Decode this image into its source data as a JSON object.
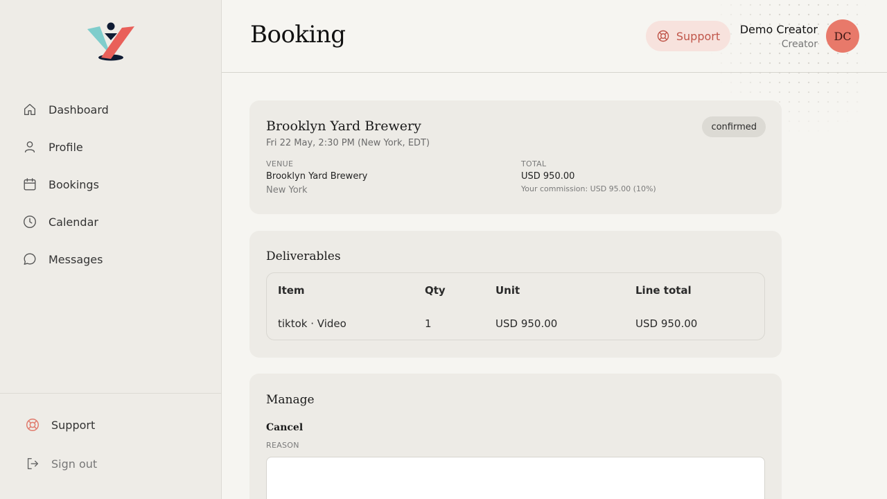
{
  "sidebar": {
    "logo": "brand-logo",
    "items": [
      {
        "label": "Dashboard",
        "icon": "home-icon"
      },
      {
        "label": "Profile",
        "icon": "user-icon"
      },
      {
        "label": "Bookings",
        "icon": "calendar-icon"
      },
      {
        "label": "Calendar",
        "icon": "clock-icon"
      },
      {
        "label": "Messages",
        "icon": "chat-bubble-icon"
      }
    ],
    "bottom": {
      "support_label": "Support",
      "signout_label": "Sign out"
    }
  },
  "header": {
    "title": "Booking",
    "support_label": "Support",
    "user_name": "Demo Creator",
    "user_role": "Creator",
    "avatar_initials": "DC"
  },
  "booking": {
    "name": "Brooklyn Yard Brewery",
    "datetime": "Fri 22 May, 2:30 PM (New York, EDT)",
    "status": "confirmed",
    "venue_label": "VENUE",
    "venue_name": "Brooklyn Yard Brewery",
    "venue_city": "New York",
    "total_label": "TOTAL",
    "total_value": "USD 950.00",
    "commission": "Your commission: USD 95.00 (10%)"
  },
  "deliverables": {
    "title": "Deliverables",
    "columns": [
      "Item",
      "Qty",
      "Unit",
      "Line total"
    ],
    "rows": [
      {
        "item": "tiktok · Video",
        "qty": "1",
        "unit": "USD 950.00",
        "line_total": "USD 950.00"
      }
    ]
  },
  "manage": {
    "title": "Manage",
    "cancel_label": "Cancel",
    "reason_label": "REASON",
    "reason_value": ""
  },
  "colors": {
    "accent": "#e8796a",
    "support_text": "#c0564a",
    "logo_teal": "#7fcdcc",
    "logo_coral": "#e9605a",
    "logo_navy": "#0f1b33"
  }
}
